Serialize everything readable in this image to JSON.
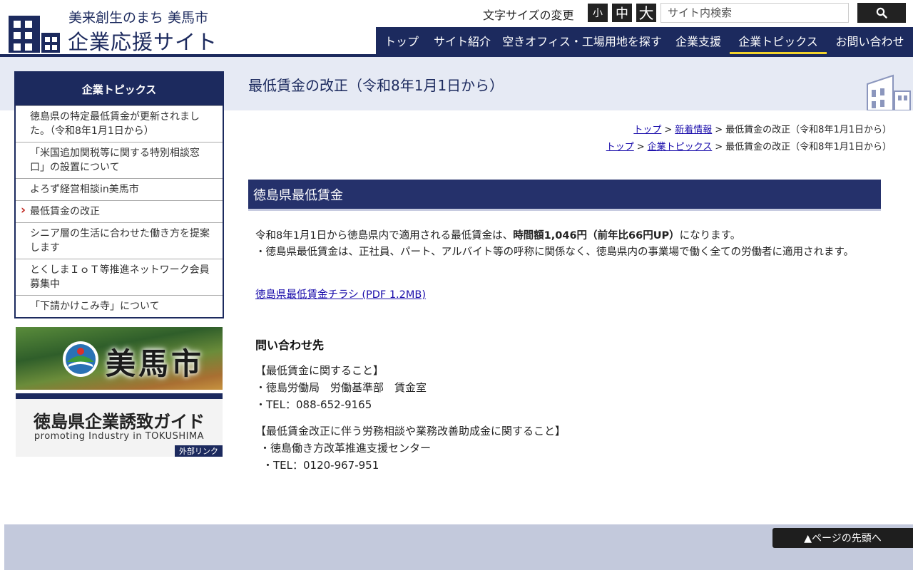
{
  "header": {
    "site_subtitle": "美来創生のまち 美馬市",
    "site_title": "企業応援サイト",
    "font_size_label": "文字サイズの変更",
    "font_size_small": "小",
    "font_size_medium": "中",
    "font_size_large": "大",
    "search_placeholder": "サイト内検索",
    "search_icon": "search-icon"
  },
  "nav": {
    "items": [
      {
        "label": "トップ"
      },
      {
        "label": "サイト紹介"
      },
      {
        "label": "空きオフィス・工場用地を探す"
      },
      {
        "label": "企業支援"
      },
      {
        "label": "企業トピックス"
      },
      {
        "label": "お問い合わせ"
      }
    ],
    "active_label": "企業トピックス"
  },
  "page": {
    "title": "最低賃金の改正（令和8年1月1日から）"
  },
  "sidebar": {
    "heading": "企業トピックス",
    "items": [
      {
        "label": "徳島県の特定最低賃金が更新されました。（令和8年1月1日から）"
      },
      {
        "label": "「米国追加関税等に関する特別相談窓口」の設置について"
      },
      {
        "label": "よろず経営相談in美馬市"
      },
      {
        "label": "最低賃金の改正"
      },
      {
        "label": "シニア層の生活に合わせた働き方を提案します"
      },
      {
        "label": "とくしまＩｏＴ等推進ネットワーク会員募集中"
      },
      {
        "label": "「下請かけこみ寺」について"
      }
    ],
    "current_label": "最低賃金の改正",
    "banner_city": "美馬市",
    "banner_guide_title": "徳島県企業誘致ガイド",
    "banner_guide_subtitle": "promoting Industry in TOKUSHIMA",
    "banner_guide_badge": "外部リンク"
  },
  "breadcrumbs": [
    {
      "links": [
        "トップ",
        "新着情報"
      ],
      "current": "最低賃金の改正（令和8年1月1日から）"
    },
    {
      "links": [
        "トップ",
        "企業トピックス"
      ],
      "current": "最低賃金の改正（令和8年1月1日から）"
    }
  ],
  "breadcrumb_separator": ">",
  "content": {
    "section_heading": "徳島県最低賃金",
    "intro_before": "令和8年1月1日から徳島県内で適用される最低賃金は、",
    "intro_bold": "時間額1,046円（前年比66円UP）",
    "intro_after": "になります。",
    "note": "・徳島県最低賃金は、正社員、パート、アルバイト等の呼称に関係なく、徳島県内の事業場で働く全ての労働者に適用されます。",
    "pdf_link": "徳島県最低賃金チラシ (PDF 1.2MB)",
    "contact_heading": "問い合わせ先",
    "contact_1_title": "【最低賃金に関すること】",
    "contact_1_org": "・徳島労働局　労働基準部　賃金室",
    "contact_1_tel": "・TEL：088-652-9165",
    "contact_2_title": "【最低賃金改正に伴う労務相談や業務改善助成金に関すること】",
    "contact_2_org": "・徳島働き方改革推進支援センター",
    "contact_2_tel": "・TEL：0120-967-951"
  },
  "footer": {
    "page_top": "▲ページの先頭へ"
  },
  "colors": {
    "brand_navy": "#1c2a5e",
    "heading_navy": "#25316b",
    "active_underline": "#f2d32b",
    "current_marker": "#c0261f"
  }
}
